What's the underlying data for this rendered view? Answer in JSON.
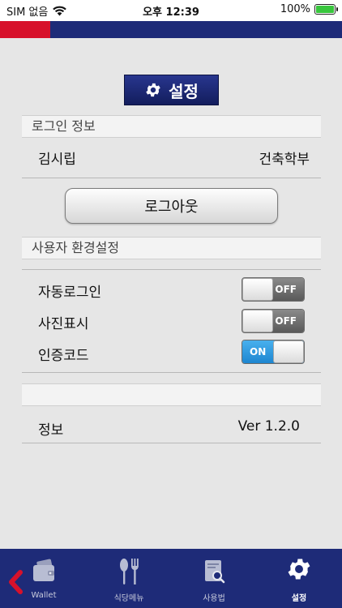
{
  "status_bar": {
    "carrier": "SIM 없음",
    "time": "오후 12:39",
    "battery": "100%"
  },
  "page": {
    "title": "설정",
    "title_icon": "gear-icon"
  },
  "login_section": {
    "header": "로그인 정보",
    "user_name": "김시립",
    "department": "건축학부"
  },
  "logout_button": {
    "label": "로그아웃"
  },
  "prefs_section": {
    "header": "사용자 환경설정",
    "items": [
      {
        "label": "자동로그인",
        "state": "OFF"
      },
      {
        "label": "사진표시",
        "state": "OFF"
      },
      {
        "label": "인증코드",
        "state": "ON"
      }
    ]
  },
  "info": {
    "label": "정보",
    "version": "Ver 1.2.0"
  },
  "tab_bar": {
    "tabs": [
      {
        "label": "Wallet",
        "icon": "wallet-icon"
      },
      {
        "label": "식당메뉴",
        "icon": "utensils-icon"
      },
      {
        "label": "사용법",
        "icon": "manual-search-icon"
      },
      {
        "label": "설정",
        "icon": "gear-icon",
        "active": true
      }
    ]
  },
  "colors": {
    "navy": "#1e2b78",
    "accent_red": "#d7112b",
    "toggle_on": "#2a93dc",
    "battery_green": "#38c63d"
  }
}
